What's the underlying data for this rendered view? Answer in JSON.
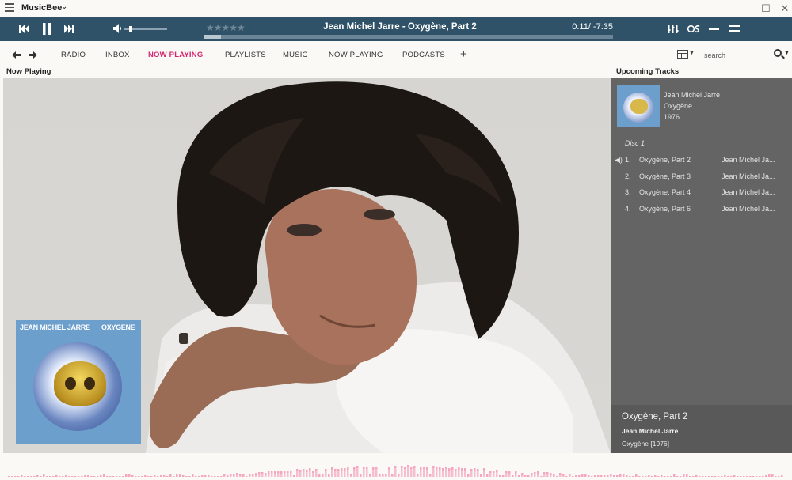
{
  "app": {
    "name": "MusicBee",
    "menu_icon": "hamburger-icon",
    "window_controls": {
      "minimize": "–",
      "maximize": "☐",
      "close": "✕"
    }
  },
  "player": {
    "now_playing_title": "Jean Michel Jarre - Oxygène, Part 2",
    "time": "0:11/ -7:35",
    "stars": "★★★★★",
    "rating": 0,
    "progress_fraction": 0.04,
    "volume_fraction": 0.12,
    "icons": [
      "previous-icon",
      "pause-icon",
      "next-icon",
      "volume-icon",
      "equalizer-icon",
      "scrobble-icon",
      "minimize-player-icon",
      "menu-lines-icon"
    ],
    "accent_color": "#2f5268"
  },
  "nav": {
    "back_icon": "back-arrow-icon",
    "forward_icon": "forward-arrow-icon",
    "tabs": [
      {
        "label": "RADIO",
        "active": false
      },
      {
        "label": "INBOX",
        "active": false
      },
      {
        "label": "NOW PLAYING",
        "active": true
      },
      {
        "label": "PLAYLISTS",
        "active": false
      },
      {
        "label": "MUSIC",
        "active": false
      },
      {
        "label": "NOW PLAYING",
        "active": false
      },
      {
        "label": "PODCASTS",
        "active": false
      }
    ],
    "add_tab": "+",
    "active_color": "#d6246e",
    "search_placeholder": "search"
  },
  "now_playing_panel": {
    "label": "Now Playing",
    "cover": {
      "artist_text": "JEAN MICHEL JARRE",
      "album_text": "OXYGENE"
    }
  },
  "upcoming_panel": {
    "label": "Upcoming Tracks",
    "album": {
      "artist": "Jean Michel Jarre",
      "title": "Oxygène",
      "year": "1976"
    },
    "disc": "Disc 1",
    "tracks": [
      {
        "num": "1.",
        "title": "Oxygène, Part 2",
        "artist": "Jean Michel Ja...",
        "playing": true
      },
      {
        "num": "2.",
        "title": "Oxygène, Part 3",
        "artist": "Jean Michel Ja...",
        "playing": false
      },
      {
        "num": "3.",
        "title": "Oxygène, Part 4",
        "artist": "Jean Michel Ja...",
        "playing": false
      },
      {
        "num": "4.",
        "title": "Oxygène, Part 6",
        "artist": "Jean Michel Ja...",
        "playing": false
      }
    ],
    "current": {
      "title": "Oxygène, Part 2",
      "artist": "Jean Michel Jarre",
      "album": "Oxygène [1976]"
    }
  },
  "spectrum": {
    "color": "#f4a7bf"
  }
}
